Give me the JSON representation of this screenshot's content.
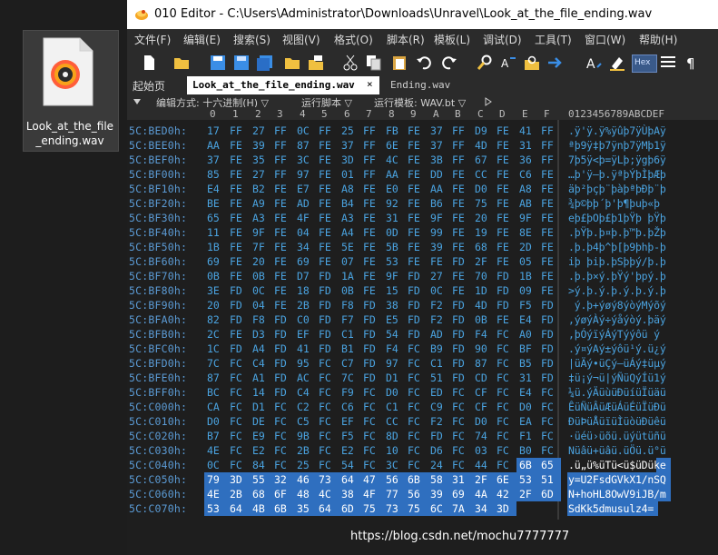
{
  "desktop": {
    "file_label": "Look_at_the_file\n_ending.wav"
  },
  "window": {
    "title": "010 Editor - C:\\Users\\Administrator\\Downloads\\Unravel\\Look_at_the_file_ending.wav"
  },
  "menu": [
    "文件(F)",
    "编辑(E)",
    "搜索(S)",
    "视图(V)",
    "格式(O)",
    "脚本(R)",
    "模板(L)",
    "调试(D)",
    "工具(T)",
    "窗口(W)",
    "帮助(H)"
  ],
  "toolbar": {
    "hex_label": "Hex"
  },
  "tabs": {
    "start": "起始页",
    "active": "Look_at_the_file_ending.wav",
    "close": "×",
    "second": "Ending.wav"
  },
  "options": {
    "edit_mode": "编辑方式: 十六进制(H) ▽",
    "run_script": "运行脚本 ▽",
    "run_template": "运行模板: WAV.bt ▽"
  },
  "columns": {
    "hex": [
      "0",
      "1",
      "2",
      "3",
      "4",
      "5",
      "6",
      "7",
      "8",
      "9",
      "A",
      "B",
      "C",
      "D",
      "E",
      "F"
    ],
    "ascii": "0123456789ABCDEF"
  },
  "rows": [
    {
      "addr": "5C:BED0h:",
      "hex": [
        "17",
        "FF",
        "27",
        "FF",
        "0C",
        "FF",
        "25",
        "FF",
        "FB",
        "FE",
        "37",
        "FF",
        "D9",
        "FE",
        "41",
        "FF"
      ],
      "ascii": ".ÿ'ÿ.ÿ%ÿûþ7ÿÙþAÿ"
    },
    {
      "addr": "5C:BEE0h:",
      "hex": [
        "AA",
        "FE",
        "39",
        "FF",
        "87",
        "FE",
        "37",
        "FF",
        "6E",
        "FE",
        "37",
        "FF",
        "4D",
        "FE",
        "31",
        "FF"
      ],
      "ascii": "ªþ9ÿ‡þ7ÿnþ7ÿMþ1ÿ"
    },
    {
      "addr": "5C:BEF0h:",
      "hex": [
        "37",
        "FE",
        "35",
        "FF",
        "3C",
        "FE",
        "3D",
        "FF",
        "4C",
        "FE",
        "3B",
        "FF",
        "67",
        "FE",
        "36",
        "FF"
      ],
      "ascii": "7þ5ÿ<þ=ÿLþ;ÿgþ6ÿ"
    },
    {
      "addr": "5C:BF00h:",
      "hex": [
        "85",
        "FE",
        "27",
        "FF",
        "97",
        "FE",
        "01",
        "FF",
        "AA",
        "FE",
        "DD",
        "FE",
        "CC",
        "FE",
        "C6",
        "FE"
      ],
      "ascii": "…þ'ÿ—þ.ÿªþÝþÌþÆþ"
    },
    {
      "addr": "5C:BF10h:",
      "hex": [
        "E4",
        "FE",
        "B2",
        "FE",
        "E7",
        "FE",
        "A8",
        "FE",
        "E0",
        "FE",
        "AA",
        "FE",
        "D0",
        "FE",
        "A8",
        "FE"
      ],
      "ascii": "äþ²þçþ¨þàþªþÐþ¨þ"
    },
    {
      "addr": "5C:BF20h:",
      "hex": [
        "BE",
        "FE",
        "A9",
        "FE",
        "AD",
        "FE",
        "B4",
        "FE",
        "92",
        "FE",
        "B6",
        "FE",
        "75",
        "FE",
        "AB",
        "FE"
      ],
      "ascii": "¾þ©þ­þ´þ'þ¶þuþ«þ"
    },
    {
      "addr": "5C:BF30h:",
      "hex": [
        "65",
        "FE",
        "A3",
        "FE",
        "4F",
        "FE",
        "A3",
        "FE",
        "31",
        "FE",
        "9F",
        "FE",
        "20",
        "FE",
        "9F",
        "FE"
      ],
      "ascii": "eþ£þOþ£þ1þŸþ þŸþ"
    },
    {
      "addr": "5C:BF40h:",
      "hex": [
        "11",
        "FE",
        "9F",
        "FE",
        "04",
        "FE",
        "A4",
        "FE",
        "0D",
        "FE",
        "99",
        "FE",
        "19",
        "FE",
        "8E",
        "FE"
      ],
      "ascii": ".þŸþ.þ¤þ.þ™þ.þŽþ"
    },
    {
      "addr": "5C:BF50h:",
      "hex": [
        "1B",
        "FE",
        "7F",
        "FE",
        "34",
        "FE",
        "5E",
        "FE",
        "5B",
        "FE",
        "39",
        "FE",
        "68",
        "FE",
        "2D",
        "FE"
      ],
      "ascii": ".þ.þ4þ^þ[þ9þhþ-þ"
    },
    {
      "addr": "5C:BF60h:",
      "hex": [
        "69",
        "FE",
        "20",
        "FE",
        "69",
        "FE",
        "07",
        "FE",
        "53",
        "FE",
        "FE",
        "FD",
        "2F",
        "FE",
        "05",
        "FE"
      ],
      "ascii": "iþ þiþ.þSþþý/þ.þ"
    },
    {
      "addr": "5C:BF70h:",
      "hex": [
        "0B",
        "FE",
        "0B",
        "FE",
        "D7",
        "FD",
        "1A",
        "FE",
        "9F",
        "FD",
        "27",
        "FE",
        "70",
        "FD",
        "1B",
        "FE"
      ],
      "ascii": ".þ.þ×ý.þŸý'þpý.þ"
    },
    {
      "addr": "5C:BF80h:",
      "hex": [
        "3E",
        "FD",
        "0C",
        "FE",
        "18",
        "FD",
        "0B",
        "FE",
        "15",
        "FD",
        "0C",
        "FE",
        "1D",
        "FD",
        "09",
        "FE"
      ],
      "ascii": ">ý.þ.ý.þ.ý.þ.ý.þ"
    },
    {
      "addr": "5C:BF90h:",
      "hex": [
        "20",
        "FD",
        "04",
        "FE",
        "2B",
        "FD",
        "F8",
        "FD",
        "38",
        "FD",
        "F2",
        "FD",
        "4D",
        "FD",
        "F5",
        "FD"
      ],
      "ascii": " ý.þ+ýøý8ýòýMýõý"
    },
    {
      "addr": "5C:BFA0h:",
      "hex": [
        "82",
        "FD",
        "F8",
        "FD",
        "C0",
        "FD",
        "F7",
        "FD",
        "E5",
        "FD",
        "F2",
        "FD",
        "0B",
        "FE",
        "E4",
        "FD"
      ],
      "ascii": "‚ýøýÀý÷ýåýòý.þäý"
    },
    {
      "addr": "5C:BFB0h:",
      "hex": [
        "2C",
        "FE",
        "D3",
        "FD",
        "EF",
        "FD",
        "C1",
        "FD",
        "54",
        "FD",
        "AD",
        "FD",
        "F4",
        "FC",
        "A0",
        "FD"
      ],
      "ascii": ",þÓýïýÁýTý­ýôü ý"
    },
    {
      "addr": "5C:BFC0h:",
      "hex": [
        "1C",
        "FD",
        "A4",
        "FD",
        "41",
        "FD",
        "B1",
        "FD",
        "F4",
        "FC",
        "B9",
        "FD",
        "90",
        "FC",
        "BF",
        "FD"
      ],
      "ascii": ".ý¤ýAý±ýôü¹ý.ü¿ý"
    },
    {
      "addr": "5C:BFD0h:",
      "hex": [
        "7C",
        "FC",
        "C4",
        "FD",
        "95",
        "FC",
        "C7",
        "FD",
        "97",
        "FC",
        "C1",
        "FD",
        "87",
        "FC",
        "B5",
        "FD"
      ],
      "ascii": "|üÄý•üÇý—üÁý‡üµý"
    },
    {
      "addr": "5C:BFE0h:",
      "hex": [
        "87",
        "FC",
        "A1",
        "FD",
        "AC",
        "FC",
        "7C",
        "FD",
        "D1",
        "FC",
        "51",
        "FD",
        "CD",
        "FC",
        "31",
        "FD"
      ],
      "ascii": "‡ü¡ý¬ü|ýÑüQýÍü1ý"
    },
    {
      "addr": "5C:BFF0h:",
      "hex": [
        "BC",
        "FC",
        "14",
        "FD",
        "C4",
        "FC",
        "F9",
        "FC",
        "D0",
        "FC",
        "ED",
        "FC",
        "CF",
        "FC",
        "E4",
        "FC"
      ],
      "ascii": "¼ü.ýÄüùüÐüíüÏüäü"
    },
    {
      "addr": "5C:C000h:",
      "hex": [
        "CA",
        "FC",
        "D1",
        "FC",
        "C2",
        "FC",
        "C6",
        "FC",
        "C1",
        "FC",
        "C9",
        "FC",
        "CF",
        "FC",
        "D0",
        "FC"
      ],
      "ascii": "ÊüÑüÂüÆüÁüÉüÏüÐü"
    },
    {
      "addr": "5C:C010h:",
      "hex": [
        "D0",
        "FC",
        "DE",
        "FC",
        "C5",
        "FC",
        "EF",
        "FC",
        "CC",
        "FC",
        "F2",
        "FC",
        "D0",
        "FC",
        "EA",
        "FC"
      ],
      "ascii": "ÐüÞüÅüïüÌüòüÐüêü"
    },
    {
      "addr": "5C:C020h:",
      "hex": [
        "B7",
        "FC",
        "E9",
        "FC",
        "9B",
        "FC",
        "F5",
        "FC",
        "8D",
        "FC",
        "FD",
        "FC",
        "74",
        "FC",
        "F1",
        "FC"
      ],
      "ascii": "·üéü›üõü.üýütüñü"
    },
    {
      "addr": "5C:C030h:",
      "hex": [
        "4E",
        "FC",
        "E2",
        "FC",
        "2B",
        "FC",
        "E2",
        "FC",
        "10",
        "FC",
        "D6",
        "FC",
        "03",
        "FC",
        "B0",
        "FC"
      ],
      "ascii": "Nüâü+üâü.üÖü.ü°ü"
    },
    {
      "addr": "5C:C040h:",
      "hex": [
        "0C",
        "FC",
        "84",
        "FC",
        "25",
        "FC",
        "54",
        "FC",
        "3C",
        "FC",
        "24",
        "FC",
        "44",
        "FC",
        "6B",
        "65"
      ],
      "ascii": ".ü„ü%üTü<ü$üDüke"
    },
    {
      "addr": "5C:C050h:",
      "hex": [
        "79",
        "3D",
        "55",
        "32",
        "46",
        "73",
        "64",
        "47",
        "56",
        "6B",
        "58",
        "31",
        "2F",
        "6E",
        "53",
        "51"
      ],
      "ascii": "y=U2FsdGVkX1/nSQ"
    },
    {
      "addr": "5C:C060h:",
      "hex": [
        "4E",
        "2B",
        "68",
        "6F",
        "48",
        "4C",
        "38",
        "4F",
        "77",
        "56",
        "39",
        "69",
        "4A",
        "42",
        "2F",
        "6D"
      ],
      "ascii": "N+hoHL8OwV9iJB/m"
    },
    {
      "addr": "5C:C070h:",
      "hex": [
        "53",
        "64",
        "4B",
        "6B",
        "35",
        "64",
        "6D",
        "75",
        "73",
        "75",
        "6C",
        "7A",
        "34",
        "3D",
        "",
        ""
      ],
      "ascii": "SdKk5dmusulz4="
    }
  ],
  "watermark": "https://blog.csdn.net/mochu7777777",
  "colors": {
    "selection": "#2f6fbf",
    "hex_text": "#4aa3e0",
    "address_text": "#5b9bd5",
    "editor_bg": "#1e1e1e"
  }
}
